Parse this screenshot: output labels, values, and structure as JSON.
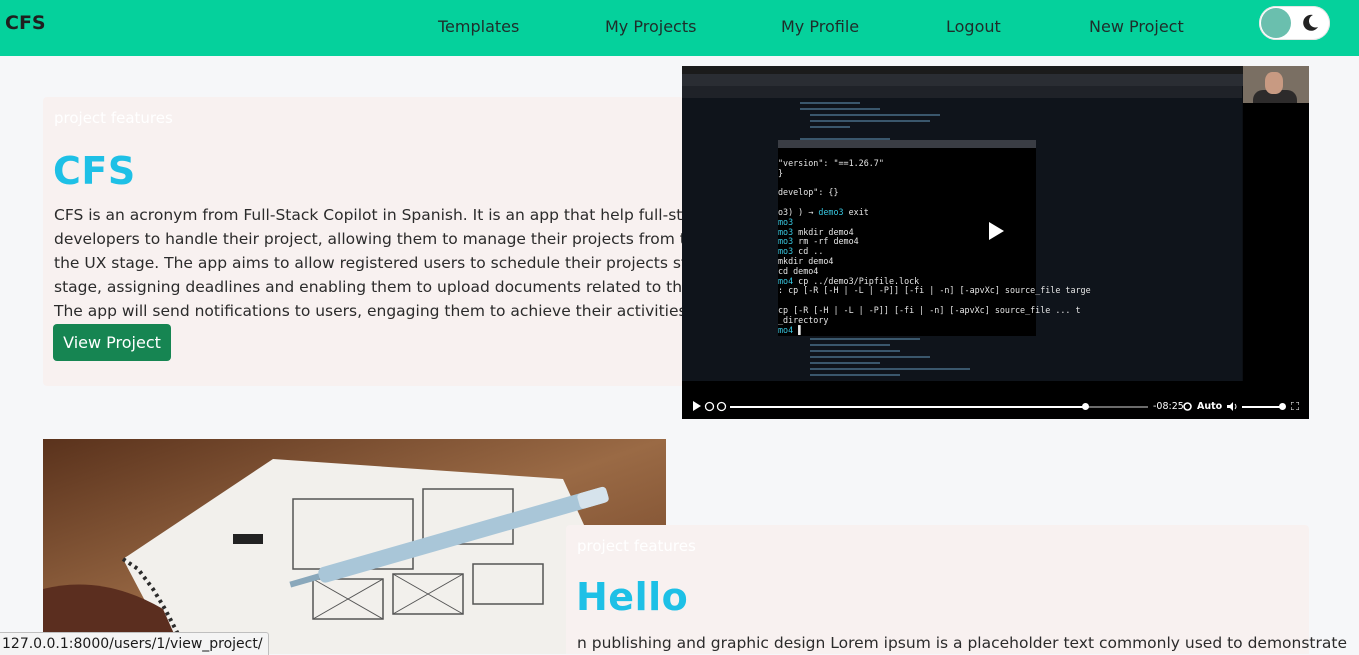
{
  "nav": {
    "brand": "CFS",
    "links": [
      "Templates",
      "My Projects",
      "My Profile",
      "Logout",
      "New Project"
    ],
    "theme_toggle_icon": "moon-icon"
  },
  "project1": {
    "eyebrow": "project features",
    "title": "CFS",
    "description": "CFS is an acronym from Full-Stack Copilot in Spanish. It is an app that help full-stack developers to handle their project, allowing them to manage their projects from the UI until the UX stage. The app aims to allow registered users to schedule their projects stage by stage, assigning deadlines and enabling them to upload documents related to the project. The app will send notifications to users, engaging them to achieve their activities.",
    "button_label": "View Project"
  },
  "video": {
    "time_remaining": "-08:25",
    "quality": "Auto",
    "progress_fraction": 0.85,
    "volume_fraction": 0.95,
    "terminal_lines": [
      {
        "prefix": "",
        "text": "   \"version\": \"==1.26.7\""
      },
      {
        "prefix": "",
        "text": "}"
      },
      {
        "prefix": "",
        "text": ""
      },
      {
        "prefix": "",
        "text": "develop\": {}"
      },
      {
        "prefix": "",
        "text": ""
      },
      {
        "prefix": "o3) ) →  ",
        "cyan": "demo3",
        "text": " exit"
      },
      {
        "prefix": "",
        "cyan": "mo3",
        "text": ""
      },
      {
        "prefix": "",
        "cyan": "mo3",
        "text": " mkdir demo4"
      },
      {
        "prefix": "",
        "cyan": "mo3",
        "text": " rm -rf demo4"
      },
      {
        "prefix": "",
        "cyan": "mo3",
        "text": " cd .."
      },
      {
        "prefix": "",
        "text": "mkdir demo4"
      },
      {
        "prefix": "",
        "text": "cd demo4"
      },
      {
        "prefix": "",
        "cyan": "mo4",
        "text": " cp ../demo3/Pipfile.lock"
      },
      {
        "prefix": "",
        "text": ": cp [-R [-H | -L | -P]] [-fi | -n] [-apvXc] source_file targe"
      },
      {
        "prefix": "",
        "text": ""
      },
      {
        "prefix": "",
        "text": "  cp [-R [-H | -L | -P]] [-fi | -n] [-apvXc] source_file ... t"
      },
      {
        "prefix": "",
        "text": "_directory"
      },
      {
        "prefix": "",
        "cyan": "mo4",
        "text": " ▌"
      }
    ]
  },
  "project2": {
    "eyebrow": "project features",
    "title": "Hello",
    "description": "n publishing and graphic design Lorem ipsum is a placeholder text commonly used to demonstrate"
  },
  "status_bar": {
    "url": "127.0.0.1:8000/users/1/view_project/"
  }
}
